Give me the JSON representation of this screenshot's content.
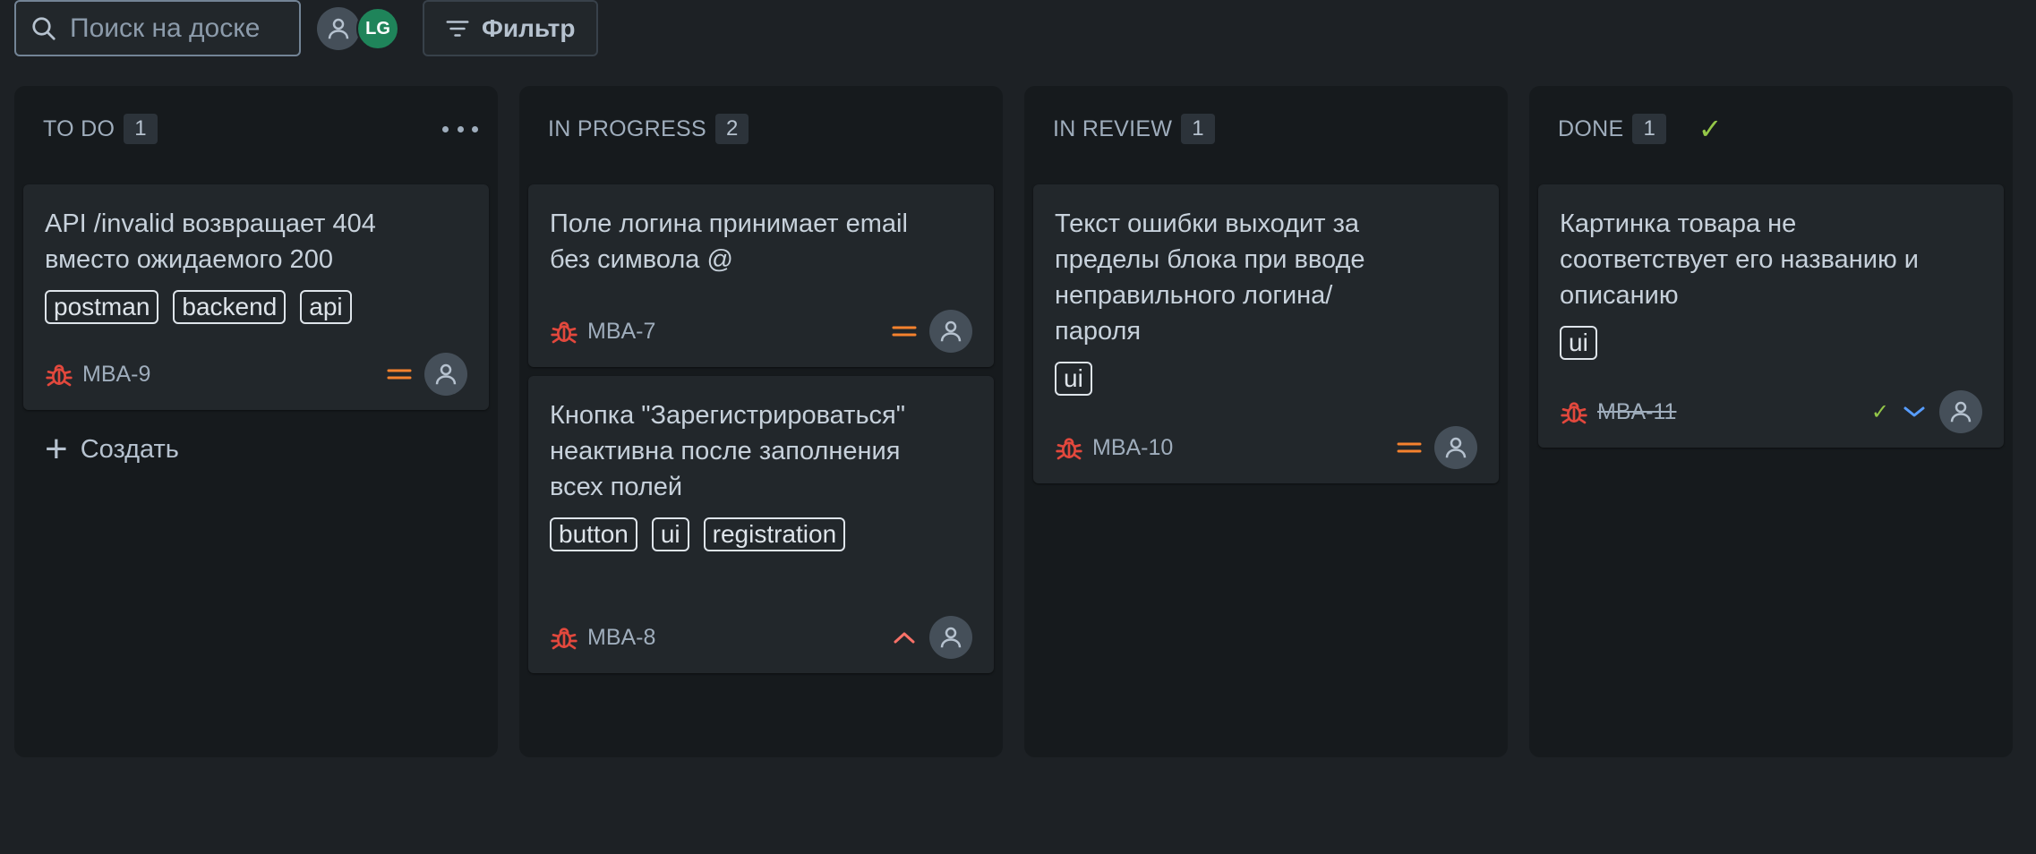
{
  "toolbar": {
    "search_placeholder": "Поиск на доске",
    "avatar_initials": "LG",
    "filter_label": "Фильтр"
  },
  "columns": [
    {
      "title": "TO DO",
      "count": "1",
      "cards": [
        {
          "title": "API /invalid возвращает 404 вместо ожидаемого 200",
          "labels": [
            "postman",
            "backend",
            "api"
          ],
          "key": "MBA-9",
          "priority": "medium"
        }
      ],
      "create_label": "Создать"
    },
    {
      "title": "IN PROGRESS",
      "count": "2",
      "cards": [
        {
          "title": "Поле логина принимает email без символа @",
          "labels": [],
          "key": "MBA-7",
          "priority": "medium"
        },
        {
          "title": "Кнопка \"Зарегистрироваться\" неактивна после заполнения всех полей",
          "labels": [
            "button",
            "ui",
            "registration"
          ],
          "key": "MBA-8",
          "priority": "high"
        }
      ]
    },
    {
      "title": "IN REVIEW",
      "count": "1",
      "cards": [
        {
          "title": "Текст ошибки выходит за пределы блока при вводе неправильного логина/ пароля",
          "labels": [
            "ui"
          ],
          "key": "MBA-10",
          "priority": "medium"
        }
      ]
    },
    {
      "title": "DONE",
      "count": "1",
      "cards": [
        {
          "title": "Картинка товара не соответствует его названию и описанию",
          "labels": [
            "ui"
          ],
          "key": "MBA-11",
          "priority": "low"
        }
      ]
    }
  ],
  "colors": {
    "background": "#1d2125",
    "column": "#161a1d",
    "card": "#22272b",
    "bug": "#e2483d",
    "priority_medium": "#f5822e",
    "priority_high": "#f87168",
    "priority_low": "#579dff",
    "done_check": "#94c748"
  },
  "icons": {
    "search": "search-icon",
    "filter": "filter-icon",
    "bug": "bug-icon",
    "avatar": "user-icon",
    "more": "more-icon",
    "check": "check-icon",
    "plus": "plus-icon"
  }
}
